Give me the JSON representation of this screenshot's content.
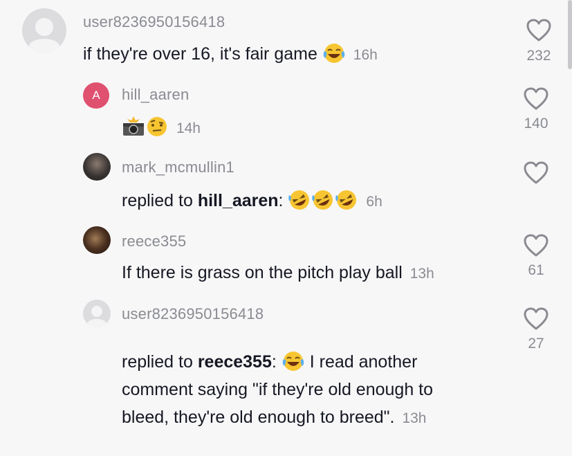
{
  "comments": [
    {
      "username": "user8236950156418",
      "text_pre": "if they're over 16, it's fair game",
      "emoji": "joy-emoji",
      "time": "16h",
      "likes": "232"
    },
    {
      "username": "hill_aaren",
      "avatar_letter": "A",
      "emojis": [
        "camera-flash-emoji",
        "raised-eyebrow-emoji"
      ],
      "time": "14h",
      "likes": "140"
    },
    {
      "username": "mark_mcmullin1",
      "reply_prefix": "replied to",
      "reply_target": "hill_aaren",
      "emojis": [
        "rofl-emoji",
        "rofl-emoji",
        "rofl-emoji"
      ],
      "time": "6h",
      "likes": ""
    },
    {
      "username": "reece355",
      "text_pre": "If there is grass on the pitch play ball",
      "time": "13h",
      "likes": "61"
    },
    {
      "username": "user8236950156418",
      "reply_prefix": "replied to",
      "reply_target": "reece355",
      "line1": " I read another",
      "line2": "comment saying \"if they're old enough to",
      "line3": "bleed, they're old enough to breed\".",
      "time": "13h",
      "likes": "27"
    }
  ]
}
